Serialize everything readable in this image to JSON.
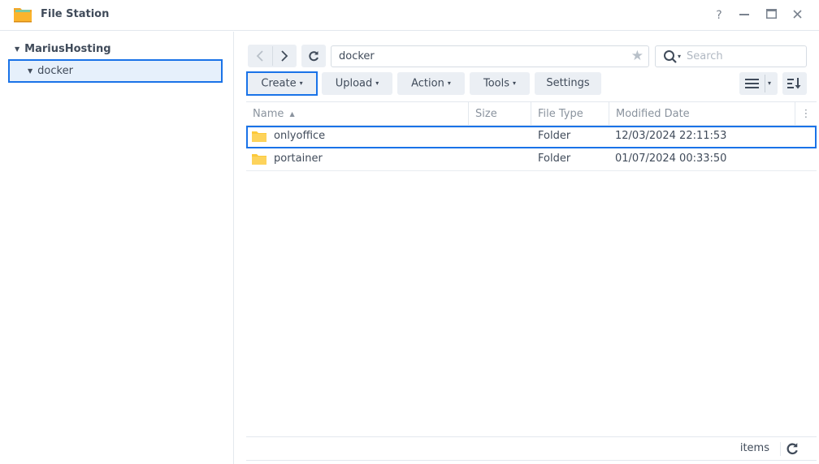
{
  "window": {
    "title": "File Station",
    "controls": {
      "help": "?",
      "minimize": "—",
      "maximize": "▭",
      "close": "✕"
    }
  },
  "sidebar": {
    "root_label": "MariusHosting",
    "selected_node": "docker"
  },
  "toolbar": {
    "path_value": "docker",
    "search_placeholder": "Search",
    "buttons": {
      "create": "Create",
      "upload": "Upload",
      "action": "Action",
      "tools": "Tools",
      "settings": "Settings"
    },
    "dropdown_glyph": "▾"
  },
  "grid": {
    "columns": [
      "Name",
      "Size",
      "File Type",
      "Modified Date"
    ],
    "sort_indicator": "▲",
    "rows": [
      {
        "name": "onlyoffice",
        "size": "",
        "type": "Folder",
        "modified": "12/03/2024 22:11:53",
        "selected": true
      },
      {
        "name": "portainer",
        "size": "",
        "type": "Folder",
        "modified": "01/07/2024 00:33:50",
        "selected": false
      }
    ]
  },
  "footer": {
    "items_label": "items"
  },
  "colors": {
    "accent": "#1a73e8",
    "selected_bg": "#e6f0fb",
    "button_bg": "#ebeff4",
    "folder": "#fcc93a"
  }
}
